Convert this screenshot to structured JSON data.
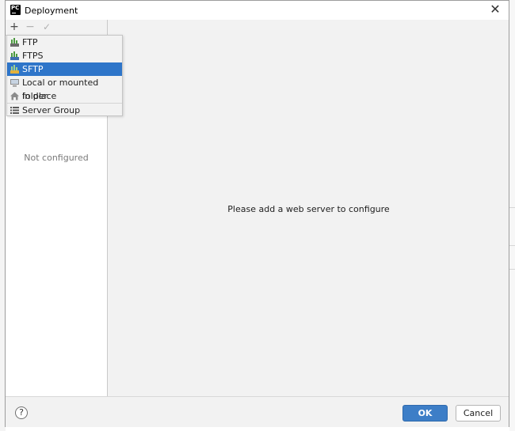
{
  "window": {
    "title": "Deployment",
    "close_glyph": "✕"
  },
  "toolbar": {
    "add_glyph": "+",
    "remove_glyph": "−",
    "apply_glyph": "✓"
  },
  "popup_menu": {
    "items": [
      {
        "label": "FTP",
        "icon": "ftp-server-icon",
        "selected": false
      },
      {
        "label": "FTPS",
        "icon": "ftps-server-icon",
        "selected": false
      },
      {
        "label": "SFTP",
        "icon": "sftp-server-icon",
        "selected": true
      },
      {
        "label": "Local or mounted folder",
        "icon": "local-folder-icon",
        "selected": false
      },
      {
        "label": "In place",
        "icon": "in-place-icon",
        "selected": false
      },
      {
        "label": "Server Group",
        "icon": "server-group-icon",
        "selected": false
      }
    ]
  },
  "left_panel": {
    "empty_text": "Not configured"
  },
  "main": {
    "message": "Please add a web server to configure"
  },
  "footer": {
    "help_glyph": "?",
    "ok_label": "OK",
    "cancel_label": "Cancel"
  },
  "colors": {
    "selection": "#2e75c9",
    "ok_button": "#3d7ec7",
    "dialog_bg": "#f2f2f2"
  }
}
